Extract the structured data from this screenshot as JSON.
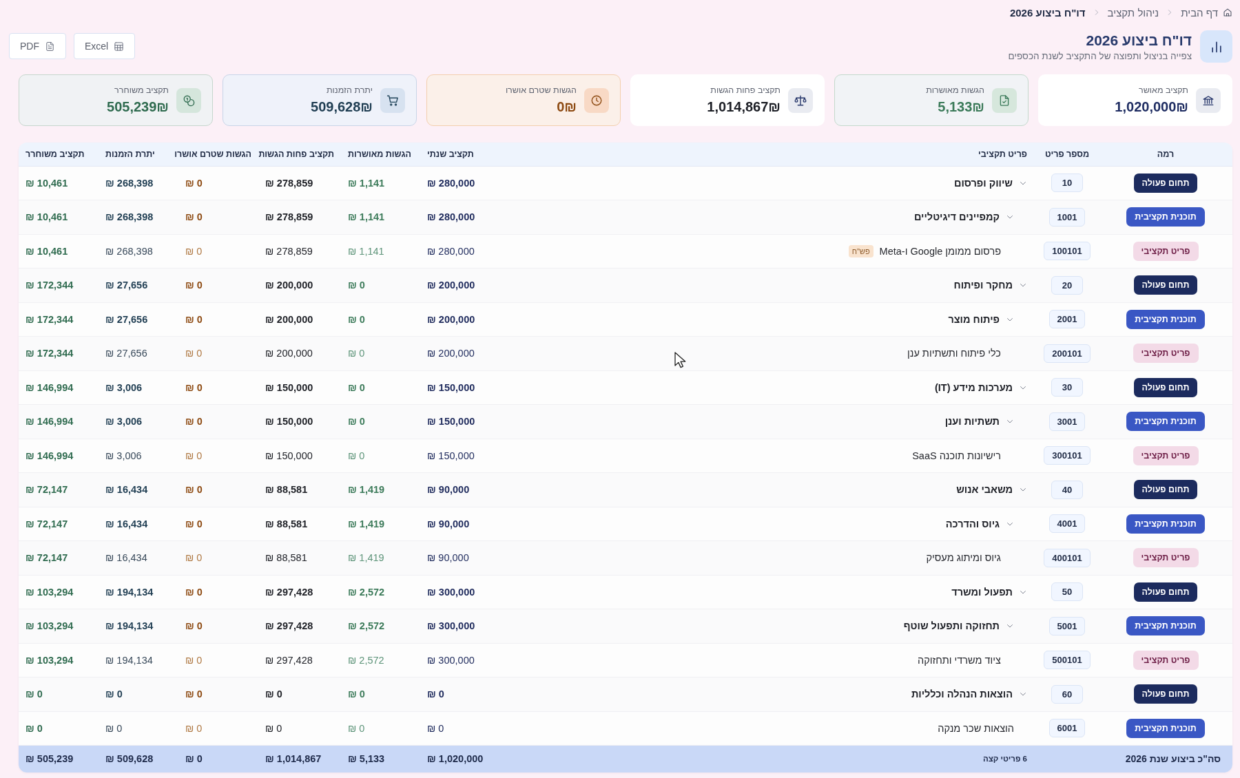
{
  "breadcrumb": [
    {
      "label": "דף הבית",
      "current": false
    },
    {
      "label": "ניהול תקציב",
      "current": false
    },
    {
      "label": "דו\"ח ביצוע 2026",
      "current": true
    }
  ],
  "header": {
    "title": "דו\"ח ביצוע 2026",
    "subtitle": "צפייה בניצול ותפוצה של התקציב לשנת הכספים"
  },
  "export_buttons": [
    {
      "label": "Excel",
      "kind": "excel"
    },
    {
      "label": "PDF",
      "kind": "pdf"
    }
  ],
  "kpis": [
    {
      "kind": "budget",
      "label": "תקציב מאושר",
      "value": "1,020,000₪"
    },
    {
      "kind": "approved",
      "label": "הגשות מאושרות",
      "value": "5,133₪"
    },
    {
      "kind": "remaining",
      "label": "תקציב פחות הגשות",
      "value": "1,014,867₪"
    },
    {
      "kind": "pending",
      "label": "הגשות שטרם אושרו",
      "value": "0₪"
    },
    {
      "kind": "orders",
      "label": "יתרת הזמנות",
      "value": "509,628₪"
    },
    {
      "kind": "released",
      "label": "תקציב משוחרר",
      "value": "505,239₪"
    }
  ],
  "table": {
    "columns": [
      "רמה",
      "מספר פריט",
      "פריט תקציבי",
      "תקציב שנתי",
      "הגשות מאושרות",
      "תקציב פחות הגשות",
      "הגשות שטרם אושרו",
      "יתרת הזמנות",
      "תקציב משוחרר"
    ],
    "rows": [
      {
        "kind": "area",
        "level": "תחום פעולה",
        "number": "10",
        "name": "שיווק ופרסום",
        "expanded": true,
        "values": [
          "₪ 280,000",
          "₪ 1,141",
          "₪ 278,859",
          "₪ 0",
          "₪ 268,398",
          "₪ 10,461"
        ],
        "children": [
          {
            "kind": "plan",
            "level": "תוכנית תקציבית",
            "number": "1001",
            "name": "קמפיינים דיגיטליים",
            "expanded": true,
            "values": [
              "₪ 280,000",
              "₪ 1,141",
              "₪ 278,859",
              "₪ 0",
              "₪ 268,398",
              "₪ 10,461"
            ],
            "children": [
              {
                "kind": "item",
                "level": "פריט תקציבי",
                "number": "100101",
                "name": "פרסום ממומן Google ו-Meta",
                "tag": "פש\"ח",
                "values": [
                  "₪ 280,000",
                  "₪ 1,141",
                  "₪ 278,859",
                  "₪ 0",
                  "₪ 268,398",
                  "₪ 10,461"
                ]
              }
            ]
          }
        ]
      },
      {
        "kind": "area",
        "level": "תחום פעולה",
        "number": "20",
        "name": "מחקר ופיתוח",
        "expanded": true,
        "values": [
          "₪ 200,000",
          "₪ 0",
          "₪ 200,000",
          "₪ 0",
          "₪ 27,656",
          "₪ 172,344"
        ],
        "children": [
          {
            "kind": "plan",
            "level": "תוכנית תקציבית",
            "number": "2001",
            "name": "פיתוח מוצר",
            "expanded": true,
            "values": [
              "₪ 200,000",
              "₪ 0",
              "₪ 200,000",
              "₪ 0",
              "₪ 27,656",
              "₪ 172,344"
            ],
            "children": [
              {
                "kind": "item",
                "level": "פריט תקציבי",
                "number": "200101",
                "name": "כלי פיתוח ותשתיות ענן",
                "values": [
                  "₪ 200,000",
                  "₪ 0",
                  "₪ 200,000",
                  "₪ 0",
                  "₪ 27,656",
                  "₪ 172,344"
                ]
              }
            ]
          }
        ]
      },
      {
        "kind": "area",
        "level": "תחום פעולה",
        "number": "30",
        "name": "מערכות מידע (IT)",
        "expanded": true,
        "values": [
          "₪ 150,000",
          "₪ 0",
          "₪ 150,000",
          "₪ 0",
          "₪ 3,006",
          "₪ 146,994"
        ],
        "children": [
          {
            "kind": "plan",
            "level": "תוכנית תקציבית",
            "number": "3001",
            "name": "תשתיות וענן",
            "expanded": true,
            "values": [
              "₪ 150,000",
              "₪ 0",
              "₪ 150,000",
              "₪ 0",
              "₪ 3,006",
              "₪ 146,994"
            ],
            "children": [
              {
                "kind": "item",
                "level": "פריט תקציבי",
                "number": "300101",
                "name": "רישיונות תוכנה SaaS",
                "values": [
                  "₪ 150,000",
                  "₪ 0",
                  "₪ 150,000",
                  "₪ 0",
                  "₪ 3,006",
                  "₪ 146,994"
                ]
              }
            ]
          }
        ]
      },
      {
        "kind": "area",
        "level": "תחום פעולה",
        "number": "40",
        "name": "משאבי אנוש",
        "expanded": true,
        "values": [
          "₪ 90,000",
          "₪ 1,419",
          "₪ 88,581",
          "₪ 0",
          "₪ 16,434",
          "₪ 72,147"
        ],
        "children": [
          {
            "kind": "plan",
            "level": "תוכנית תקציבית",
            "number": "4001",
            "name": "גיוס והדרכה",
            "expanded": true,
            "values": [
              "₪ 90,000",
              "₪ 1,419",
              "₪ 88,581",
              "₪ 0",
              "₪ 16,434",
              "₪ 72,147"
            ],
            "children": [
              {
                "kind": "item",
                "level": "פריט תקציבי",
                "number": "400101",
                "name": "גיוס ומיתוג מעסיק",
                "values": [
                  "₪ 90,000",
                  "₪ 1,419",
                  "₪ 88,581",
                  "₪ 0",
                  "₪ 16,434",
                  "₪ 72,147"
                ]
              }
            ]
          }
        ]
      },
      {
        "kind": "area",
        "level": "תחום פעולה",
        "number": "50",
        "name": "תפעול ומשרד",
        "expanded": true,
        "values": [
          "₪ 300,000",
          "₪ 2,572",
          "₪ 297,428",
          "₪ 0",
          "₪ 194,134",
          "₪ 103,294"
        ],
        "children": [
          {
            "kind": "plan",
            "level": "תוכנית תקציבית",
            "number": "5001",
            "name": "תחזוקה ותפעול שוטף",
            "expanded": true,
            "values": [
              "₪ 300,000",
              "₪ 2,572",
              "₪ 297,428",
              "₪ 0",
              "₪ 194,134",
              "₪ 103,294"
            ],
            "children": [
              {
                "kind": "item",
                "level": "פריט תקציבי",
                "number": "500101",
                "name": "ציוד משרדי ותחזוקה",
                "values": [
                  "₪ 300,000",
                  "₪ 2,572",
                  "₪ 297,428",
                  "₪ 0",
                  "₪ 194,134",
                  "₪ 103,294"
                ]
              }
            ]
          }
        ]
      },
      {
        "kind": "area",
        "level": "תחום פעולה",
        "number": "60",
        "name": "הוצאות הנהלה וכלליות",
        "expanded": true,
        "values": [
          "₪ 0",
          "₪ 0",
          "₪ 0",
          "₪ 0",
          "₪ 0",
          "₪ 0"
        ],
        "children": [
          {
            "kind": "plan",
            "level": "תוכנית תקציבית",
            "number": "6001",
            "name": "הוצאות שכר מנקה",
            "values": [
              "₪ 0",
              "₪ 0",
              "₪ 0",
              "₪ 0",
              "₪ 0",
              "₪ 0"
            ]
          }
        ]
      }
    ],
    "total": {
      "label": "סה\"כ ביצוע שנת 2026",
      "count": "6 פריטי קצה",
      "values": [
        "₪ 1,020,000",
        "₪ 5,133",
        "₪ 1,014,867",
        "₪ 0",
        "₪ 509,628",
        "₪ 505,239"
      ]
    }
  }
}
